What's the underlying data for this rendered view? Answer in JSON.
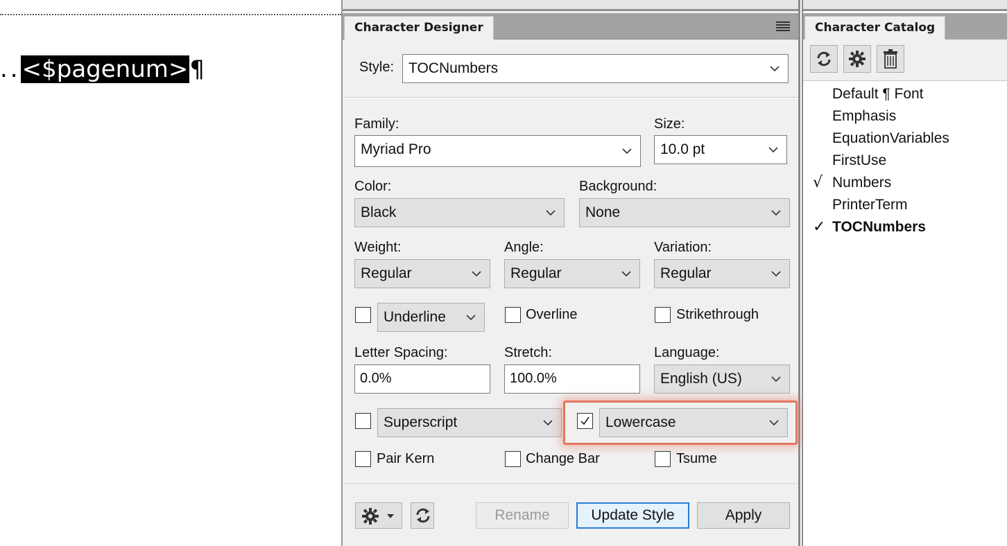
{
  "document": {
    "leader": "..",
    "selected_text": "<$pagenum>",
    "para_mark": "¶"
  },
  "designer": {
    "tab_title": "Character Designer",
    "style_label": "Style:",
    "style_value": "TOCNumbers",
    "family_label": "Family:",
    "family_value": "Myriad Pro",
    "size_label": "Size:",
    "size_value": "10.0 pt",
    "color_label": "Color:",
    "color_value": "Black",
    "background_label": "Background:",
    "background_value": "None",
    "weight_label": "Weight:",
    "weight_value": "Regular",
    "angle_label": "Angle:",
    "angle_value": "Regular",
    "variation_label": "Variation:",
    "variation_value": "Regular",
    "underline_value": "Underline",
    "overline_label": "Overline",
    "strikethrough_label": "Strikethrough",
    "letter_spacing_label": "Letter Spacing:",
    "letter_spacing_value": "0.0%",
    "stretch_label": "Stretch:",
    "stretch_value": "100.0%",
    "language_label": "Language:",
    "language_value": "English (US)",
    "superscript_value": "Superscript",
    "case_value": "Lowercase",
    "case_checked": true,
    "pair_kern_label": "Pair Kern",
    "change_bar_label": "Change Bar",
    "tsume_label": "Tsume",
    "rename_label": "Rename",
    "update_style_label": "Update Style",
    "apply_label": "Apply"
  },
  "catalog": {
    "tab_title": "Character Catalog",
    "items": [
      {
        "label": "Default ¶ Font",
        "check": "",
        "bold": false
      },
      {
        "label": "Emphasis",
        "check": "",
        "bold": false
      },
      {
        "label": "EquationVariables",
        "check": "",
        "bold": false
      },
      {
        "label": "FirstUse",
        "check": "",
        "bold": false
      },
      {
        "label": "Numbers",
        "check": "√",
        "bold": false
      },
      {
        "label": "PrinterTerm",
        "check": "",
        "bold": false
      },
      {
        "label": "TOCNumbers",
        "check": "✓",
        "bold": true
      }
    ]
  },
  "colors": {
    "highlight": "#e4765f",
    "primary_button_border": "#2a7bd6"
  }
}
